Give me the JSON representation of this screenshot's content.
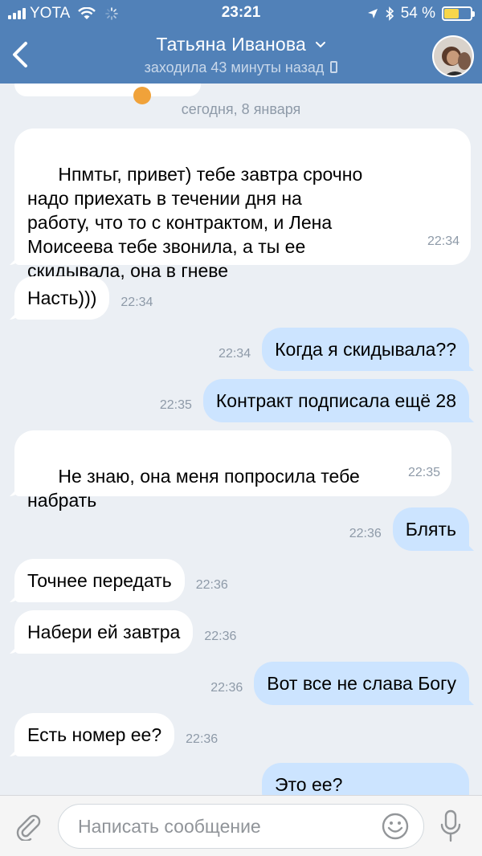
{
  "status_bar": {
    "carrier": "YOTA",
    "time": "23:21",
    "battery_percent_text": "54 %",
    "battery_level": 0.54,
    "icons": [
      "signal-icon",
      "wifi-icon",
      "spinner-icon",
      "location-arrow-icon",
      "bluetooth-icon",
      "battery-icon"
    ]
  },
  "header": {
    "back_icon": "chevron-left-icon",
    "contact_name": "Татьяна Иванова",
    "title_chevron_icon": "chevron-down-icon",
    "last_seen": "заходила 43 минуты назад",
    "device_icon": "phone-icon",
    "avatar": "contact-avatar"
  },
  "chat": {
    "date_separator": "сегодня, 8 января",
    "messages": [
      {
        "direction": "in",
        "text": "Нпмтьг, привет) тебе завтра срочно\nнадо приехать в течении дня на\nработу, что то с контрактом, и Лена\nМоисеева тебе звонила, а ты ее\nскидывала, она в гневе",
        "time": "22:34"
      },
      {
        "direction": "in",
        "text": "Насть)))",
        "time": "22:34"
      },
      {
        "direction": "out",
        "text": "Когда я скидывала??",
        "time": "22:34"
      },
      {
        "direction": "out",
        "text": "Контракт подписала ещё 28",
        "time": "22:35"
      },
      {
        "direction": "in",
        "text": "Не знаю, она меня попросила тебе\nнабрать",
        "time": "22:35"
      },
      {
        "direction": "out",
        "text": "Блять",
        "time": "22:36"
      },
      {
        "direction": "in",
        "text": "Точнее передать",
        "time": "22:36"
      },
      {
        "direction": "in",
        "text": "Набери ей завтра",
        "time": "22:36"
      },
      {
        "direction": "out",
        "text": "Вот все не слава Богу",
        "time": "22:36"
      },
      {
        "direction": "in",
        "text": "Есть номер ее?",
        "time": "22:36"
      },
      {
        "direction": "out",
        "text": "Это ее?",
        "time": ""
      }
    ]
  },
  "input_bar": {
    "attach_icon": "paperclip-icon",
    "placeholder": "Написать сообщение",
    "value": "",
    "emoji_icon": "smiley-icon",
    "mic_icon": "microphone-icon"
  },
  "colors": {
    "header_bg": "#5181b8",
    "chat_bg": "#ebeff4",
    "incoming_bubble": "#ffffff",
    "outgoing_bubble": "#cce4ff",
    "timestamp": "#8e9aa8",
    "battery_fill": "#f7d64a"
  }
}
